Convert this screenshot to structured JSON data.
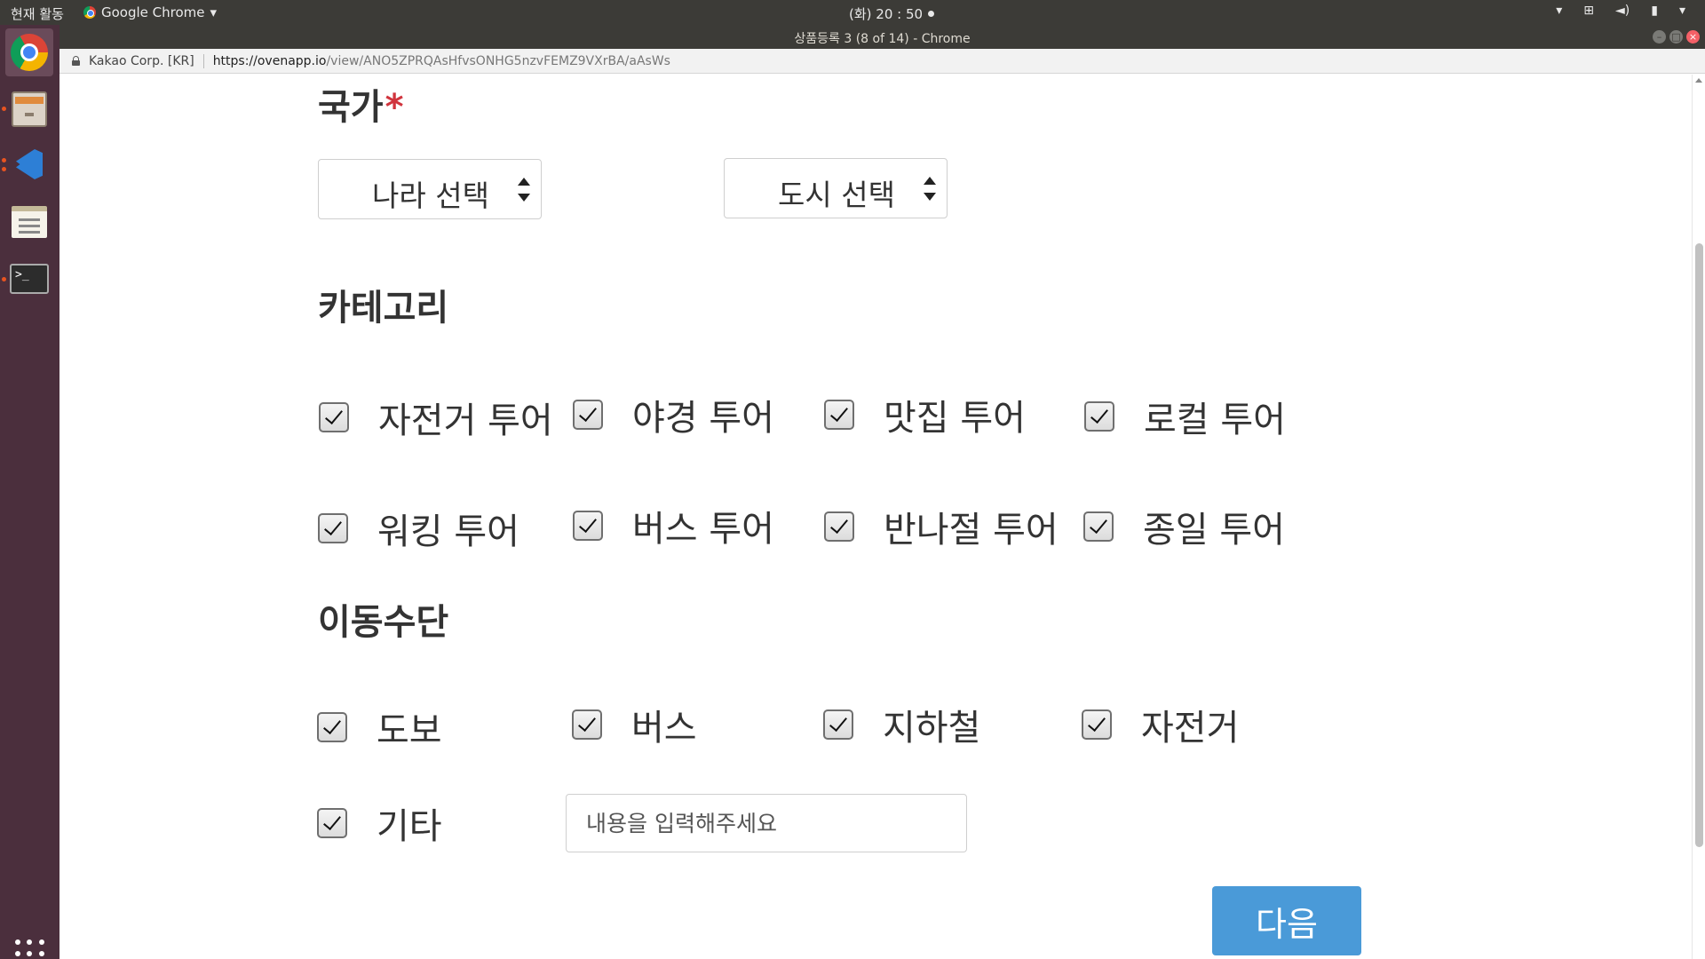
{
  "system_panel": {
    "activities": "현재 활동",
    "app_menu": "Google Chrome",
    "clock": "(화) 20 : 50"
  },
  "window": {
    "title": "상품등록 3 (8 of 14) - Chrome"
  },
  "address_bar": {
    "org": "Kakao Corp. [KR]",
    "url_host": "https://ovenapp.io",
    "url_path": "/view/ANO5ZPRQAsHfvsONHG5nzvFEMZ9VXrBA/aAsWs"
  },
  "launcher": {
    "items": [
      "chrome-icon",
      "files-icon",
      "vscode-icon",
      "text-editor-icon",
      "terminal-icon"
    ],
    "terminal_prompt": ">_"
  },
  "form": {
    "country": {
      "title": "국가",
      "required_mark": "*",
      "country_select": "나라 선택",
      "city_select": "도시 선택"
    },
    "category": {
      "title": "카테고리",
      "items": [
        {
          "label": "자전거 투어",
          "checked": true
        },
        {
          "label": "야경 투어",
          "checked": true
        },
        {
          "label": "맛집 투어",
          "checked": true
        },
        {
          "label": "로컬 투어",
          "checked": true
        },
        {
          "label": "워킹 투어",
          "checked": true
        },
        {
          "label": "버스 투어",
          "checked": true
        },
        {
          "label": "반나절 투어",
          "checked": true
        },
        {
          "label": "종일 투어",
          "checked": true
        }
      ]
    },
    "transport": {
      "title": "이동수단",
      "items": [
        {
          "label": "도보",
          "checked": true
        },
        {
          "label": "버스",
          "checked": true
        },
        {
          "label": "지하철",
          "checked": true
        },
        {
          "label": "자전거",
          "checked": true
        },
        {
          "label": "기타",
          "checked": true
        }
      ],
      "other_placeholder": "내용을 입력해주세요"
    },
    "next_label": "다음"
  },
  "colors": {
    "accent": "#4a9ad8",
    "required": "#d0343d",
    "launcher_bg": "#4b2f3d",
    "panel_bg": "#3c3b37"
  }
}
